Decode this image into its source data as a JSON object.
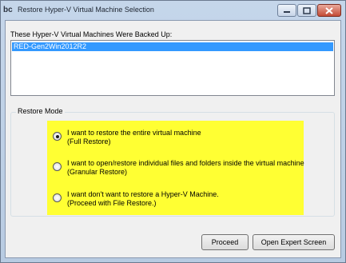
{
  "window": {
    "logo_text": "bc",
    "title": "Restore Hyper-V Virtual Machine Selection",
    "minimize_glyph": "—",
    "maximize_glyph": "▢",
    "close_glyph": "✕"
  },
  "backed_up": {
    "label": "These Hyper-V Virtual Machines Were Backed Up:",
    "items": [
      "RED-Gen2Win2012R2"
    ],
    "selected_index": 0
  },
  "restore_mode": {
    "legend": "Restore Mode",
    "highlight_color": "#ffff33",
    "options": [
      {
        "line1": "I want to restore the entire virtual machine",
        "line2": "(Full Restore)",
        "checked": true
      },
      {
        "line1": "I want to open/restore individual files and folders inside the virtual machine",
        "line2": "(Granular Restore)",
        "checked": false
      },
      {
        "line1": "I want don't want to restore a Hyper-V Machine.",
        "line2": "(Proceed with File Restore.)",
        "checked": false
      }
    ]
  },
  "buttons": {
    "proceed": "Proceed",
    "expert": "Open Expert Screen"
  }
}
